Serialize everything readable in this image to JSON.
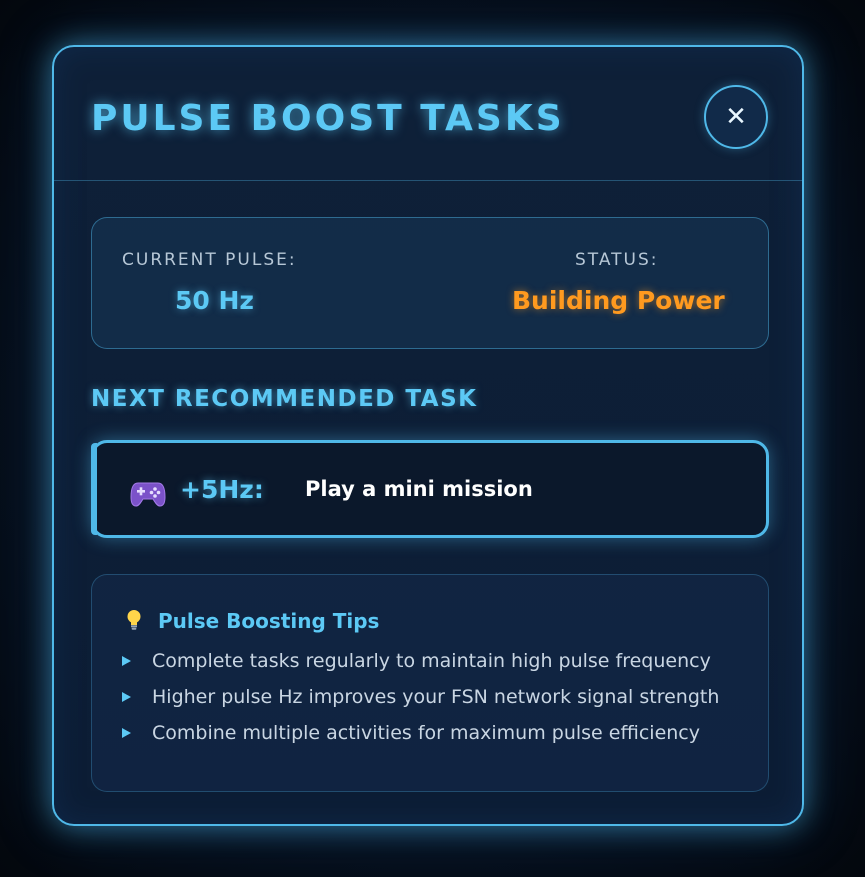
{
  "modal": {
    "title": "PULSE BOOST TASKS",
    "close_icon": "close-icon"
  },
  "status": {
    "pulse_label": "CURRENT PULSE:",
    "pulse_value": "50 Hz",
    "status_label": "STATUS:",
    "status_value": "Building Power",
    "status_color": "#ff9a1f"
  },
  "next_task": {
    "heading": "NEXT RECOMMENDED TASK",
    "icon": "gamepad-icon",
    "reward": "+5Hz:",
    "description": "Play a mini mission"
  },
  "tips": {
    "icon": "lightbulb-icon",
    "heading": "Pulse Boosting Tips",
    "items": [
      "Complete tasks regularly to maintain high pulse frequency",
      "Higher pulse Hz improves your FSN network signal strength",
      "Combine multiple activities for maximum pulse efficiency"
    ]
  },
  "colors": {
    "accent": "#5cc9f5",
    "border": "#4fb8e8",
    "warning": "#ff9a1f",
    "background": "#0c1d35"
  }
}
